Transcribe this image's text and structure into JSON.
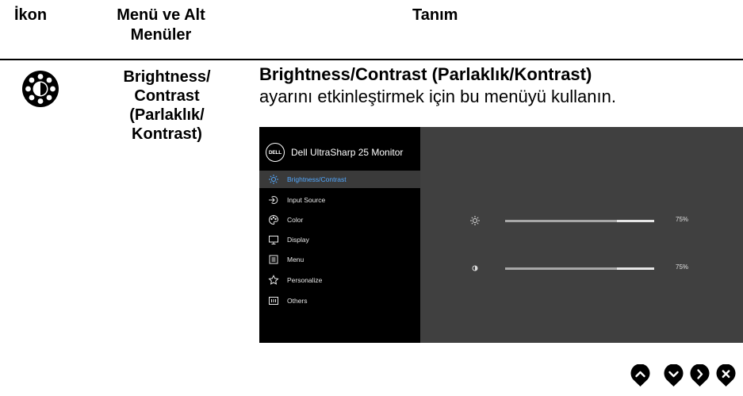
{
  "header": {
    "icon_col": "İkon",
    "menu_col_line1": "Menü ve Alt",
    "menu_col_line2": "Menüler",
    "desc_col": "Tanım"
  },
  "row": {
    "icon": "brightness-contrast-icon",
    "menu_name": [
      "Brightness/",
      "Contrast",
      "(Parlaklık/",
      "Kontrast)"
    ],
    "desc_bold": "Brightness/Contrast (Parlaklık/Kontrast)",
    "desc_rest": "ayarını etkinleştirmek için bu menüyü kullanın."
  },
  "osd": {
    "logo": "DELL",
    "title": "Dell UltraSharp 25 Monitor",
    "accent_color": "#52a8ff",
    "menu": [
      {
        "label": "Brightness/Contrast",
        "icon": "brightness-icon",
        "selected": true
      },
      {
        "label": "Input Source",
        "icon": "input-source-icon",
        "selected": false
      },
      {
        "label": "Color",
        "icon": "color-icon",
        "selected": false
      },
      {
        "label": "Display",
        "icon": "display-icon",
        "selected": false
      },
      {
        "label": "Menu",
        "icon": "menu-icon",
        "selected": false
      },
      {
        "label": "Personalize",
        "icon": "star-icon",
        "selected": false
      },
      {
        "label": "Others",
        "icon": "others-icon",
        "selected": false
      }
    ],
    "sliders": [
      {
        "name": "brightness",
        "icon": "brightness-icon",
        "value": 75,
        "label": "75%"
      },
      {
        "name": "contrast",
        "icon": "contrast-icon",
        "value": 75,
        "label": "75%"
      }
    ]
  },
  "nav_buttons": [
    "up-icon",
    "down-icon",
    "right-icon",
    "close-icon"
  ]
}
